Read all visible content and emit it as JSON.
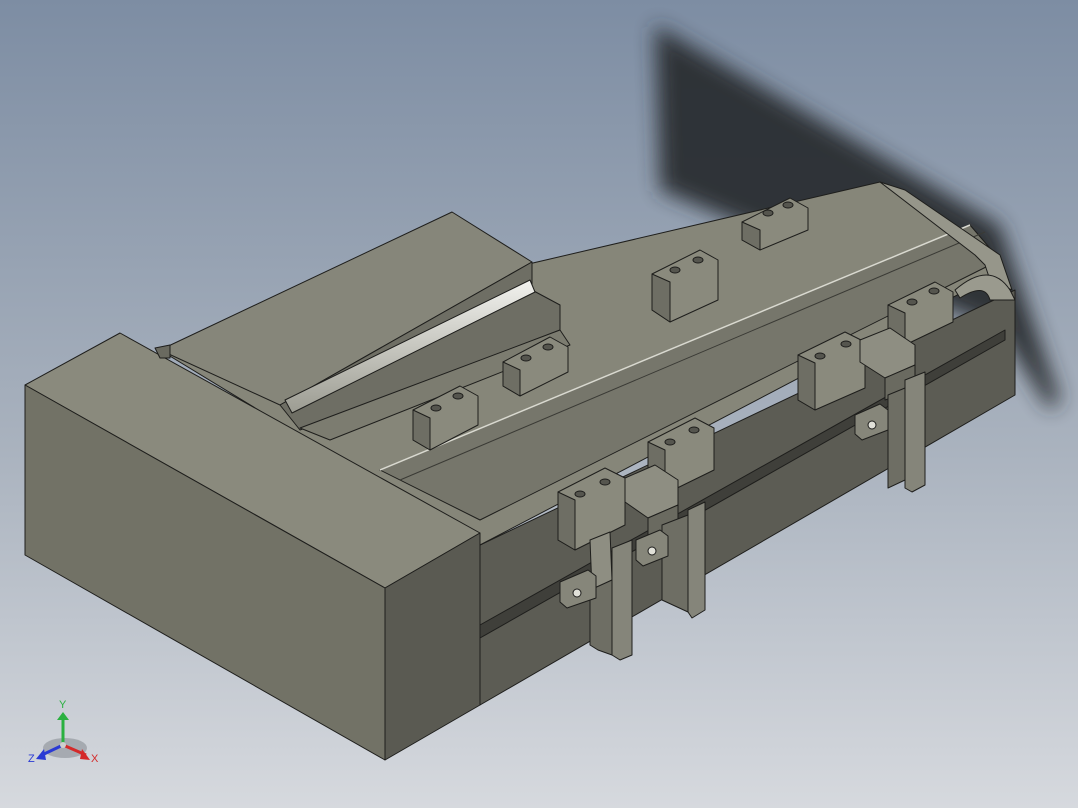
{
  "viewport": {
    "background_top": "#7f8fa4",
    "background_bottom": "#d4d8de",
    "model_body_color": "#7a7a6e",
    "model_side_color": "#5e5e56",
    "model_top_color": "#8a8a7e",
    "edge_color": "#1e1e1c",
    "shadow_color": "#2d3135"
  },
  "view_cube": {
    "x_label": "X",
    "y_label": "Y",
    "z_label": "Z",
    "x_color": "#d42a2a",
    "y_color": "#2ab040",
    "z_color": "#2a3ad4"
  }
}
